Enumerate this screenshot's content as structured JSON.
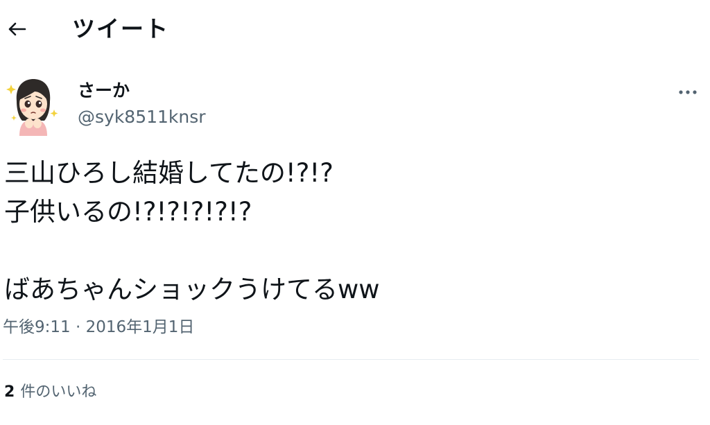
{
  "header": {
    "title": "ツイート",
    "back_icon": "arrow-left-icon"
  },
  "tweet": {
    "author": {
      "display_name": "さーか",
      "handle": "@syk8511knsr",
      "avatar_icon": "girl-worried-avatar"
    },
    "more_icon": "more-horizontal-icon",
    "lines": [
      "三山ひろし結婚してたの!?!?",
      "子供いるの!?!?!?!?!?",
      "",
      "ばあちゃんショックうけてるww"
    ],
    "timestamp": "午後9:11 · 2016年1月1日",
    "likes": {
      "count": "2",
      "label": "件のいいね"
    }
  },
  "colors": {
    "text": "#0f1419",
    "secondary": "#536471",
    "divider": "#e6ecf0"
  }
}
